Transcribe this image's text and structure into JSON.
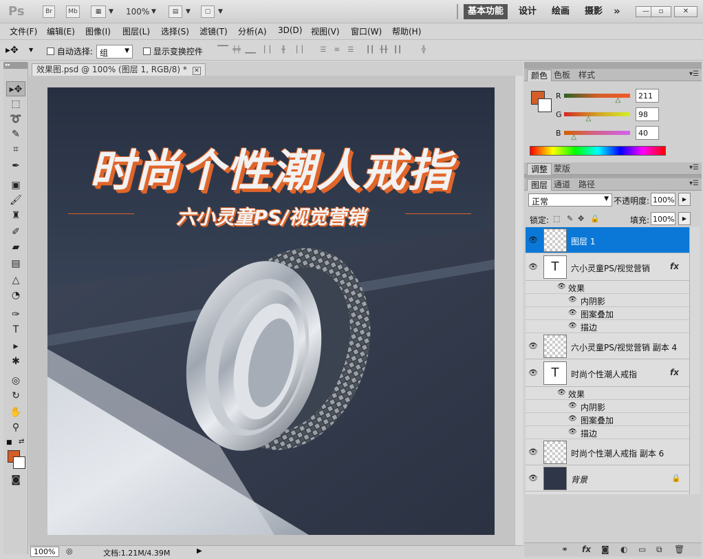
{
  "app": {
    "logo": "Ps",
    "title_buttons": [
      "Br",
      "Mb"
    ],
    "zoom_menu": "100%",
    "workspaces": [
      "基本功能",
      "设计",
      "绘画",
      "摄影"
    ],
    "workspace_more": "»",
    "window_controls": {
      "minimize": "—",
      "restore": "▫",
      "close": "✕"
    }
  },
  "menubar": {
    "items": [
      "文件(F)",
      "编辑(E)",
      "图像(I)",
      "图层(L)",
      "选择(S)",
      "滤镜(T)",
      "分析(A)",
      "3D(D)",
      "视图(V)",
      "窗口(W)",
      "帮助(H)"
    ]
  },
  "options": {
    "auto_select_label": "自动选择:",
    "auto_select_value": "组",
    "show_transform_label": "显示变换控件"
  },
  "document": {
    "tab_title": "效果图.psd @ 100% (图层 1, RGB/8) *",
    "poster_title": "时尚个性潮人戒指",
    "poster_subtitle": "六小灵童PS/视觉营销",
    "status_zoom": "100%",
    "status_doc": "文档:1.21M/4.39M"
  },
  "color_panel": {
    "tabs": [
      "颜色",
      "色板",
      "样式"
    ],
    "fg_color": "#d35e28",
    "channels": [
      {
        "label": "R",
        "value": "211",
        "level": 0.83
      },
      {
        "label": "G",
        "value": "98",
        "level": 0.38
      },
      {
        "label": "B",
        "value": "40",
        "level": 0.16
      }
    ]
  },
  "adjust_panel": {
    "tabs": [
      "调整",
      "蒙版"
    ]
  },
  "layers_panel": {
    "tabs": [
      "图层",
      "通道",
      "路径"
    ],
    "blend_mode": "正常",
    "opacity_label": "不透明度:",
    "opacity": "100%",
    "lock_label": "锁定:",
    "fill_label": "填充:",
    "fill": "100%",
    "layers": [
      {
        "name": "图层 1",
        "type": "pixel",
        "selected": true
      },
      {
        "name": "六小灵童PS/视觉营销",
        "type": "text",
        "fx": "fx",
        "effects_label": "效果",
        "effects": [
          "内阴影",
          "图案叠加",
          "描边"
        ]
      },
      {
        "name": "六小灵童PS/视觉营销 副本 4",
        "type": "pixel"
      },
      {
        "name": "时尚个性潮人戒指",
        "type": "text",
        "fx": "fx",
        "effects_label": "效果",
        "effects": [
          "内阴影",
          "图案叠加",
          "描边"
        ]
      },
      {
        "name": "时尚个性潮人戒指 副本 6",
        "type": "pixel"
      },
      {
        "name": "背景",
        "type": "background",
        "locked": true
      }
    ]
  }
}
